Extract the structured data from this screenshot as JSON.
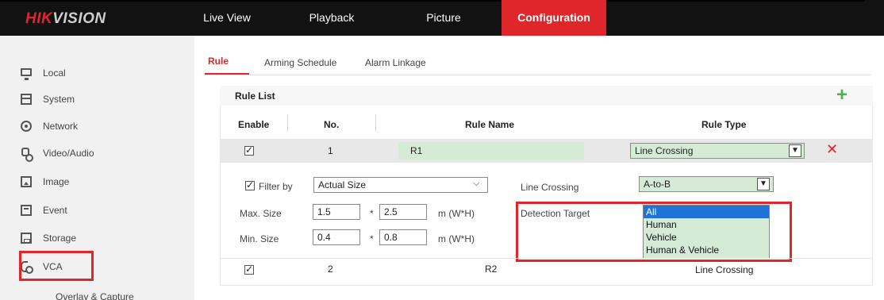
{
  "header": {
    "logo_hik": "HIK",
    "logo_vision": "VISION",
    "nav": [
      {
        "label": "Live View"
      },
      {
        "label": "Playback"
      },
      {
        "label": "Picture"
      },
      {
        "label": "Configuration"
      }
    ],
    "active_nav": "Configuration"
  },
  "sidebar": {
    "items": [
      {
        "label": "Local",
        "icon": "monitor-icon"
      },
      {
        "label": "System",
        "icon": "system-icon"
      },
      {
        "label": "Network",
        "icon": "network-icon"
      },
      {
        "label": "Video/Audio",
        "icon": "video-audio-icon"
      },
      {
        "label": "Image",
        "icon": "image-icon"
      },
      {
        "label": "Event",
        "icon": "event-icon"
      },
      {
        "label": "Storage",
        "icon": "storage-icon"
      },
      {
        "label": "VCA",
        "icon": "vca-icon"
      }
    ],
    "sub_item": "Overlay & Capture"
  },
  "tabs": [
    {
      "label": "Rule"
    },
    {
      "label": "Arming Schedule"
    },
    {
      "label": "Alarm Linkage"
    }
  ],
  "rule_list": {
    "title": "Rule List",
    "columns": {
      "enable": "Enable",
      "no": "No.",
      "rule_name": "Rule Name",
      "rule_type": "Rule Type"
    },
    "rows": [
      {
        "no": "1",
        "name": "R1",
        "type": "Line Crossing",
        "enabled": true
      },
      {
        "no": "2",
        "name": "R2",
        "type": "Line Crossing",
        "enabled": true
      }
    ]
  },
  "details": {
    "filter_by_label": "Filter by",
    "filter_by_value": "Actual Size",
    "max_size_label": "Max. Size",
    "max_w": "1.5",
    "max_h": "2.5",
    "min_size_label": "Min. Size",
    "min_w": "0.4",
    "min_h": "0.8",
    "times": "*",
    "unit": "m (W*H)",
    "line_crossing_label": "Line Crossing",
    "line_crossing_value": "A-to-B",
    "detection_target_label": "Detection Target",
    "detection_target_options": [
      "All",
      "Human",
      "Vehicle",
      "Human & Vehicle"
    ],
    "detection_target_selected": "All"
  },
  "colors": {
    "accent": "#e0252b",
    "topbar": "#121212",
    "sidebar_bg": "#f1f1f1",
    "field_green": "#d6ebd6",
    "selection_blue": "#1e73d8",
    "add_green": "#4caf50"
  }
}
